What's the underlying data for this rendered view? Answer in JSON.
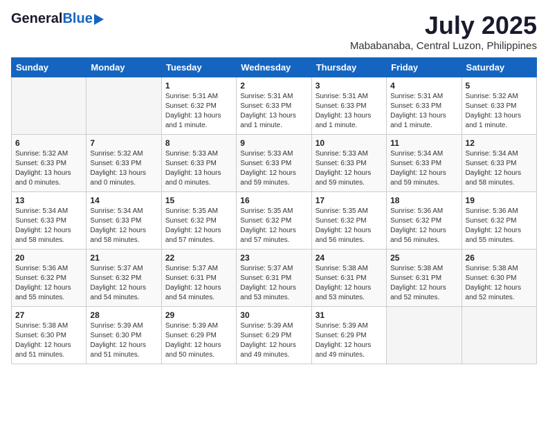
{
  "header": {
    "logo": {
      "general": "General",
      "blue": "Blue"
    },
    "title": "July 2025",
    "subtitle": "Mababanaba, Central Luzon, Philippines"
  },
  "calendar": {
    "weekdays": [
      "Sunday",
      "Monday",
      "Tuesday",
      "Wednesday",
      "Thursday",
      "Friday",
      "Saturday"
    ],
    "weeks": [
      [
        {
          "day": "",
          "empty": true
        },
        {
          "day": "",
          "empty": true
        },
        {
          "day": "1",
          "sunrise": "5:31 AM",
          "sunset": "6:32 PM",
          "daylight": "13 hours and 1 minute."
        },
        {
          "day": "2",
          "sunrise": "5:31 AM",
          "sunset": "6:33 PM",
          "daylight": "13 hours and 1 minute."
        },
        {
          "day": "3",
          "sunrise": "5:31 AM",
          "sunset": "6:33 PM",
          "daylight": "13 hours and 1 minute."
        },
        {
          "day": "4",
          "sunrise": "5:31 AM",
          "sunset": "6:33 PM",
          "daylight": "13 hours and 1 minute."
        },
        {
          "day": "5",
          "sunrise": "5:32 AM",
          "sunset": "6:33 PM",
          "daylight": "13 hours and 1 minute."
        }
      ],
      [
        {
          "day": "6",
          "sunrise": "5:32 AM",
          "sunset": "6:33 PM",
          "daylight": "13 hours and 0 minutes."
        },
        {
          "day": "7",
          "sunrise": "5:32 AM",
          "sunset": "6:33 PM",
          "daylight": "13 hours and 0 minutes."
        },
        {
          "day": "8",
          "sunrise": "5:33 AM",
          "sunset": "6:33 PM",
          "daylight": "13 hours and 0 minutes."
        },
        {
          "day": "9",
          "sunrise": "5:33 AM",
          "sunset": "6:33 PM",
          "daylight": "12 hours and 59 minutes."
        },
        {
          "day": "10",
          "sunrise": "5:33 AM",
          "sunset": "6:33 PM",
          "daylight": "12 hours and 59 minutes."
        },
        {
          "day": "11",
          "sunrise": "5:34 AM",
          "sunset": "6:33 PM",
          "daylight": "12 hours and 59 minutes."
        },
        {
          "day": "12",
          "sunrise": "5:34 AM",
          "sunset": "6:33 PM",
          "daylight": "12 hours and 58 minutes."
        }
      ],
      [
        {
          "day": "13",
          "sunrise": "5:34 AM",
          "sunset": "6:33 PM",
          "daylight": "12 hours and 58 minutes."
        },
        {
          "day": "14",
          "sunrise": "5:34 AM",
          "sunset": "6:33 PM",
          "daylight": "12 hours and 58 minutes."
        },
        {
          "day": "15",
          "sunrise": "5:35 AM",
          "sunset": "6:32 PM",
          "daylight": "12 hours and 57 minutes."
        },
        {
          "day": "16",
          "sunrise": "5:35 AM",
          "sunset": "6:32 PM",
          "daylight": "12 hours and 57 minutes."
        },
        {
          "day": "17",
          "sunrise": "5:35 AM",
          "sunset": "6:32 PM",
          "daylight": "12 hours and 56 minutes."
        },
        {
          "day": "18",
          "sunrise": "5:36 AM",
          "sunset": "6:32 PM",
          "daylight": "12 hours and 56 minutes."
        },
        {
          "day": "19",
          "sunrise": "5:36 AM",
          "sunset": "6:32 PM",
          "daylight": "12 hours and 55 minutes."
        }
      ],
      [
        {
          "day": "20",
          "sunrise": "5:36 AM",
          "sunset": "6:32 PM",
          "daylight": "12 hours and 55 minutes."
        },
        {
          "day": "21",
          "sunrise": "5:37 AM",
          "sunset": "6:32 PM",
          "daylight": "12 hours and 54 minutes."
        },
        {
          "day": "22",
          "sunrise": "5:37 AM",
          "sunset": "6:31 PM",
          "daylight": "12 hours and 54 minutes."
        },
        {
          "day": "23",
          "sunrise": "5:37 AM",
          "sunset": "6:31 PM",
          "daylight": "12 hours and 53 minutes."
        },
        {
          "day": "24",
          "sunrise": "5:38 AM",
          "sunset": "6:31 PM",
          "daylight": "12 hours and 53 minutes."
        },
        {
          "day": "25",
          "sunrise": "5:38 AM",
          "sunset": "6:31 PM",
          "daylight": "12 hours and 52 minutes."
        },
        {
          "day": "26",
          "sunrise": "5:38 AM",
          "sunset": "6:30 PM",
          "daylight": "12 hours and 52 minutes."
        }
      ],
      [
        {
          "day": "27",
          "sunrise": "5:38 AM",
          "sunset": "6:30 PM",
          "daylight": "12 hours and 51 minutes."
        },
        {
          "day": "28",
          "sunrise": "5:39 AM",
          "sunset": "6:30 PM",
          "daylight": "12 hours and 51 minutes."
        },
        {
          "day": "29",
          "sunrise": "5:39 AM",
          "sunset": "6:29 PM",
          "daylight": "12 hours and 50 minutes."
        },
        {
          "day": "30",
          "sunrise": "5:39 AM",
          "sunset": "6:29 PM",
          "daylight": "12 hours and 49 minutes."
        },
        {
          "day": "31",
          "sunrise": "5:39 AM",
          "sunset": "6:29 PM",
          "daylight": "12 hours and 49 minutes."
        },
        {
          "day": "",
          "empty": true
        },
        {
          "day": "",
          "empty": true
        }
      ]
    ],
    "labels": {
      "sunrise": "Sunrise:",
      "sunset": "Sunset:",
      "daylight": "Daylight:"
    }
  }
}
